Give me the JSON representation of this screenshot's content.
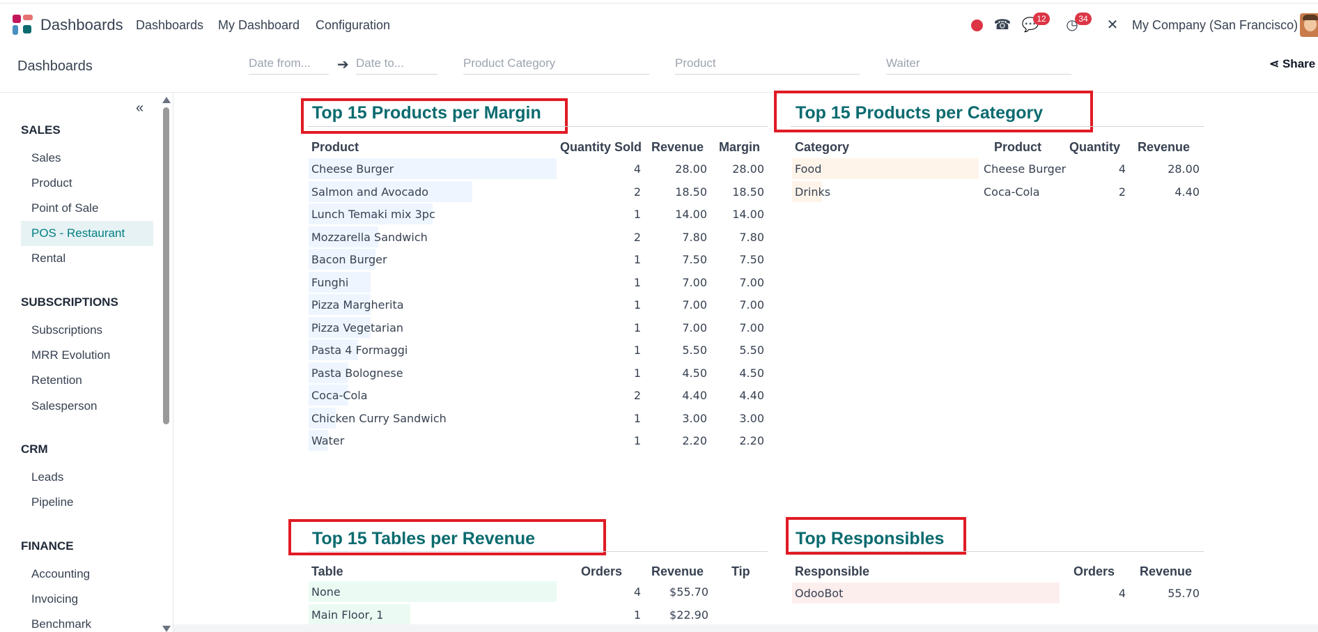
{
  "app": {
    "name": "Dashboards",
    "nav": [
      "Dashboards",
      "My Dashboard",
      "Configuration"
    ],
    "messages_badge": "12",
    "activities_badge": "34",
    "company": "My Company (San Francisco)",
    "logo_colors": [
      "#c2185b",
      "#e57373",
      "#4a90c2",
      "#0b6b6f"
    ]
  },
  "subbar": {
    "title": "Dashboards",
    "date_from_placeholder": "Date from...",
    "date_to_placeholder": "Date to...",
    "category_placeholder": "Product Category",
    "product_placeholder": "Product",
    "waiter_placeholder": "Waiter",
    "share_label": "Share"
  },
  "sidebar": {
    "sections": [
      {
        "title": "SALES",
        "items": [
          "Sales",
          "Product",
          "Point of Sale",
          "POS - Restaurant",
          "Rental"
        ]
      },
      {
        "title": "SUBSCRIPTIONS",
        "items": [
          "Subscriptions",
          "MRR Evolution",
          "Retention",
          "Salesperson"
        ]
      },
      {
        "title": "CRM",
        "items": [
          "Leads",
          "Pipeline"
        ]
      },
      {
        "title": "FINANCE",
        "items": [
          "Accounting",
          "Invoicing",
          "Benchmark"
        ]
      }
    ],
    "active_item": "POS - Restaurant"
  },
  "margin_table": {
    "title": "Top 15 Products per Margin",
    "headers": [
      "Product",
      "Quantity Sold",
      "Revenue",
      "Margin"
    ],
    "bar_color": "#eef5ff",
    "rows": [
      {
        "product": "Cheese Burger",
        "qty": "4",
        "revenue": "28.00",
        "margin": "28.00",
        "share": 1.0
      },
      {
        "product": "Salmon and Avocado",
        "qty": "2",
        "revenue": "18.50",
        "margin": "18.50",
        "share": 0.66
      },
      {
        "product": "Lunch Temaki mix 3pc",
        "qty": "1",
        "revenue": "14.00",
        "margin": "14.00",
        "share": 0.5
      },
      {
        "product": "Mozzarella Sandwich",
        "qty": "2",
        "revenue": "7.80",
        "margin": "7.80",
        "share": 0.28
      },
      {
        "product": "Bacon Burger",
        "qty": "1",
        "revenue": "7.50",
        "margin": "7.50",
        "share": 0.27
      },
      {
        "product": "Funghi",
        "qty": "1",
        "revenue": "7.00",
        "margin": "7.00",
        "share": 0.25
      },
      {
        "product": "Pizza Margherita",
        "qty": "1",
        "revenue": "7.00",
        "margin": "7.00",
        "share": 0.25
      },
      {
        "product": "Pizza Vegetarian",
        "qty": "1",
        "revenue": "7.00",
        "margin": "7.00",
        "share": 0.25
      },
      {
        "product": "Pasta 4 Formaggi",
        "qty": "1",
        "revenue": "5.50",
        "margin": "5.50",
        "share": 0.2
      },
      {
        "product": "Pasta Bolognese",
        "qty": "1",
        "revenue": "4.50",
        "margin": "4.50",
        "share": 0.16
      },
      {
        "product": "Coca-Cola",
        "qty": "2",
        "revenue": "4.40",
        "margin": "4.40",
        "share": 0.16
      },
      {
        "product": "Chicken Curry Sandwich",
        "qty": "1",
        "revenue": "3.00",
        "margin": "3.00",
        "share": 0.11
      },
      {
        "product": "Water",
        "qty": "1",
        "revenue": "2.20",
        "margin": "2.20",
        "share": 0.08
      }
    ]
  },
  "category_table": {
    "title": "Top 15 Products per Category",
    "headers": [
      "Category",
      "Product",
      "Quantity",
      "Revenue"
    ],
    "bar_color": "#fff4ea",
    "rows": [
      {
        "category": "Food",
        "product": "Cheese Burger",
        "qty": "4",
        "revenue": "28.00",
        "share": 1.0
      },
      {
        "category": "Drinks",
        "product": "Coca-Cola",
        "qty": "2",
        "revenue": "4.40",
        "share": 0.16
      }
    ]
  },
  "tables_table": {
    "title": "Top 15 Tables per Revenue",
    "headers": [
      "Table",
      "Orders",
      "Revenue",
      "Tip"
    ],
    "bar_color": "#ebfbf3",
    "rows": [
      {
        "table": "None",
        "orders": "4",
        "revenue": "$55.70",
        "tip": "",
        "share": 1.0
      },
      {
        "table": "Main Floor, 1",
        "orders": "1",
        "revenue": "$22.90",
        "tip": "",
        "share": 0.41
      }
    ]
  },
  "responsibles_table": {
    "title": "Top Responsibles",
    "headers": [
      "Responsible",
      "Orders",
      "Revenue"
    ],
    "bar_color": "#fdeeee",
    "rows": [
      {
        "responsible": "OdooBot",
        "orders": "4",
        "revenue": "55.70",
        "share": 1.0
      }
    ]
  },
  "highlight_color": "#e01b24"
}
